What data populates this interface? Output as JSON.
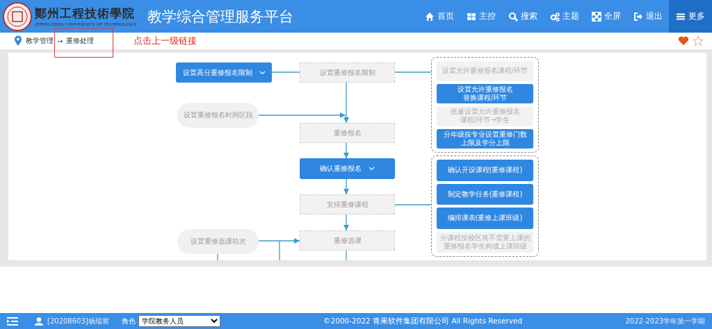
{
  "header": {
    "logo": {
      "name": "鄭州工程技術學院",
      "subtitle": "ZHENGZHOU UNIVERSITY OF TECHNOLOGY"
    },
    "title": "教学综合管理服务平台",
    "nav": [
      {
        "label": "首页",
        "selected": false
      },
      {
        "label": "主控",
        "selected": false
      },
      {
        "label": "搜索",
        "selected": false
      },
      {
        "label": "主题",
        "selected": false
      },
      {
        "label": "全屏",
        "selected": false
      },
      {
        "label": "退出",
        "selected": false
      },
      {
        "label": "更多",
        "selected": true
      }
    ]
  },
  "breadcrumb": {
    "items": [
      "教学管理",
      "重修处理"
    ],
    "separator": "→",
    "favorite": true,
    "starred": false
  },
  "annotation": {
    "text": "点击上一级链接"
  },
  "flow": {
    "nodes": [
      {
        "kind": "primary",
        "label": "设置高分重修报名限制",
        "dropdown": true
      },
      {
        "kind": "step",
        "label": "设置重修报名限制",
        "dropdown": false
      },
      {
        "kind": "pill",
        "label": "设置重修报名时间区段",
        "dropdown": false
      },
      {
        "kind": "step",
        "label": "重修报名",
        "dropdown": false
      },
      {
        "kind": "primary",
        "label": "确认重修报名",
        "dropdown": true
      },
      {
        "kind": "step",
        "label": "安排重修课程",
        "dropdown": false
      },
      {
        "kind": "pill",
        "label": "设置重修选课轮次",
        "dropdown": false
      },
      {
        "kind": "step",
        "label": "重修选课",
        "dropdown": false
      }
    ],
    "groups": [
      {
        "items": [
          {
            "kind": "muted",
            "lines": [
              "设置允许重修报名课程/环节"
            ]
          },
          {
            "kind": "primary",
            "lines": [
              "设置允许重修报名",
              "替换课程/环节"
            ]
          },
          {
            "kind": "muted",
            "lines": [
              "批量设置允许重修报名",
              "课程/环节→学生"
            ]
          },
          {
            "kind": "primary",
            "lines": [
              "分年级按专业设置重修门数",
              "上限及学分上限"
            ]
          }
        ]
      },
      {
        "items": [
          {
            "kind": "primary",
            "lines": [
              "确认开设课程(重修课程)"
            ]
          },
          {
            "kind": "primary",
            "lines": [
              "制定教学任务(重修课程)"
            ]
          },
          {
            "kind": "primary",
            "lines": [
              "编排课表(重修上课班级)"
            ]
          },
          {
            "kind": "muted",
            "lines": [
              "分课程按校区将不需要上课的",
              "重修报名学生构成上课班级"
            ]
          }
        ]
      }
    ]
  },
  "footer": {
    "user": "[20208603]杨瑞宸",
    "role_label": "角色",
    "role_value": "学院教务人员",
    "copyright": "©2000-2022 青果软件集团有限公司 All Rights Reserved",
    "term": "2022-2023学年第一学期"
  }
}
